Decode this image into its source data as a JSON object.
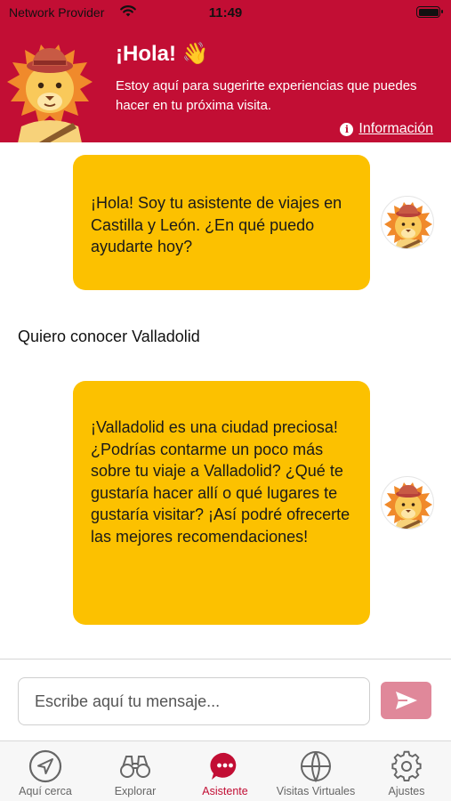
{
  "status_bar": {
    "carrier": "Network Provider",
    "time": "11:49"
  },
  "header": {
    "title": "¡Hola! 👋",
    "subtitle": "Estoy aquí para sugerirte experiencias que puedes hacer en tu próxima visita.",
    "info_label": "Información",
    "mascot_icon": "lion-mascot-icon"
  },
  "chat": {
    "messages": [
      {
        "from": "assistant",
        "text": "¡Hola! Soy tu asistente de viajes en Castilla y León. ¿En qué puedo ayudarte hoy?"
      },
      {
        "from": "user",
        "text": "Quiero conocer Valladolid"
      },
      {
        "from": "assistant",
        "text": "¡Valladolid es una ciudad preciosa! ¿Podrías contarme un poco más sobre tu viaje a Valladolid? ¿Qué te gustaría hacer allí o qué lugares te gustaría visitar? ¡Así podré ofrecerte las mejores recomendaciones!"
      }
    ]
  },
  "composer": {
    "placeholder": "Escribe aquí tu mensaje...",
    "value": "",
    "send_icon": "send-icon"
  },
  "tabbar": {
    "tabs": [
      {
        "label": "Aquí cerca",
        "icon": "navigation-arrow-icon",
        "active": false
      },
      {
        "label": "Explorar",
        "icon": "binoculars-icon",
        "active": false
      },
      {
        "label": "Asistente",
        "icon": "chat-bubble-icon",
        "active": true
      },
      {
        "label": "Visitas Virtuales",
        "icon": "globe-icon",
        "active": false
      },
      {
        "label": "Ajustes",
        "icon": "gear-icon",
        "active": false
      }
    ]
  },
  "colors": {
    "brand_red": "#c20e34",
    "assistant_bubble": "#fcc100",
    "send_button": "#e0889a",
    "tab_inactive": "#666666"
  }
}
